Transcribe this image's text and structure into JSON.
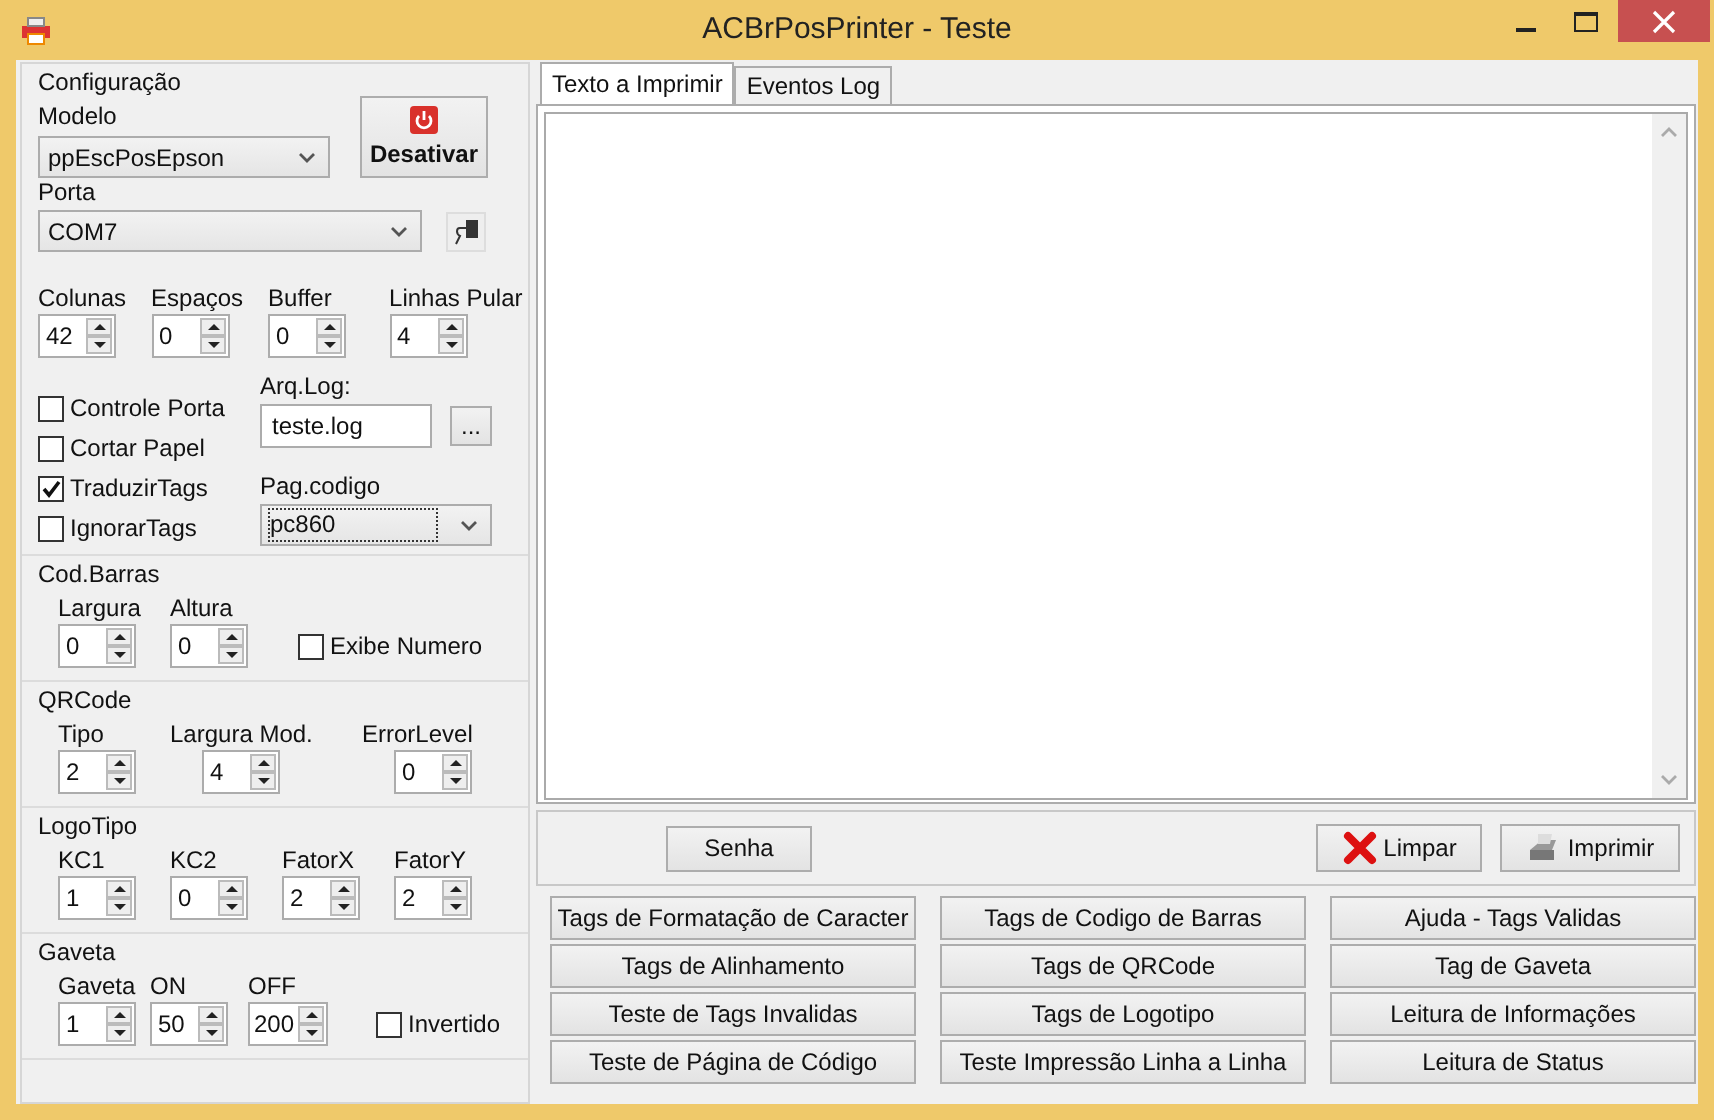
{
  "window": {
    "title": "ACBrPosPrinter - Teste"
  },
  "config": {
    "title": "Configuração",
    "model": {
      "label": "Modelo",
      "value": "ppEscPosEpson"
    },
    "deactivate": "Desativar",
    "port": {
      "label": "Porta",
      "value": "COM7"
    },
    "spins": [
      {
        "label": "Colunas",
        "value": "42"
      },
      {
        "label": "Espaços",
        "value": "0"
      },
      {
        "label": "Buffer",
        "value": "0"
      },
      {
        "label": "Linhas Pular",
        "value": "4"
      }
    ],
    "checkboxes": [
      {
        "label": "Controle Porta",
        "checked": false
      },
      {
        "label": "Cortar Papel",
        "checked": false
      },
      {
        "label": "TraduzirTags",
        "checked": true
      },
      {
        "label": "IgnorarTags",
        "checked": false
      }
    ],
    "log": {
      "label": "Arq.Log:",
      "value": "teste.log",
      "browse": "..."
    },
    "codepage": {
      "label": "Pag.codigo",
      "value": "pc860"
    }
  },
  "groups": [
    {
      "title": "Cod.Barras",
      "spins": [
        {
          "label": "Largura",
          "value": "0"
        },
        {
          "label": "Altura",
          "value": "0"
        }
      ],
      "checkbox": {
        "label": "Exibe Numero",
        "checked": false
      }
    },
    {
      "title": "QRCode",
      "spins": [
        {
          "label": "Tipo",
          "value": "2"
        },
        {
          "label": "Largura Mod.",
          "value": "4"
        },
        {
          "label": "ErrorLevel",
          "value": "0"
        }
      ]
    },
    {
      "title": "LogoTipo",
      "spins": [
        {
          "label": "KC1",
          "value": "1"
        },
        {
          "label": "KC2",
          "value": "0"
        },
        {
          "label": "FatorX",
          "value": "2"
        },
        {
          "label": "FatorY",
          "value": "2"
        }
      ]
    },
    {
      "title": "Gaveta",
      "spins": [
        {
          "label": "Gaveta",
          "value": "1"
        },
        {
          "label": "ON",
          "value": "50"
        },
        {
          "label": "OFF",
          "value": "200"
        }
      ],
      "checkbox": {
        "label": "Invertido",
        "checked": false
      }
    }
  ],
  "tabs": [
    {
      "label": "Texto a Imprimir",
      "selected": true
    },
    {
      "label": "Eventos Log",
      "selected": false
    }
  ],
  "actions": {
    "password": "Senha",
    "clear": "Limpar",
    "print": "Imprimir"
  },
  "buttons": [
    "Tags de Formatação de Caracter",
    "Tags de Codigo de Barras",
    "Ajuda - Tags Validas",
    "Tags de Alinhamento",
    "Tags de QRCode",
    "Tag de Gaveta",
    "Teste de Tags Invalidas",
    "Tags de Logotipo",
    "Leitura de Informações",
    "Teste de Página de Código",
    "Teste Impressão Linha a Linha",
    "Leitura de Status"
  ]
}
